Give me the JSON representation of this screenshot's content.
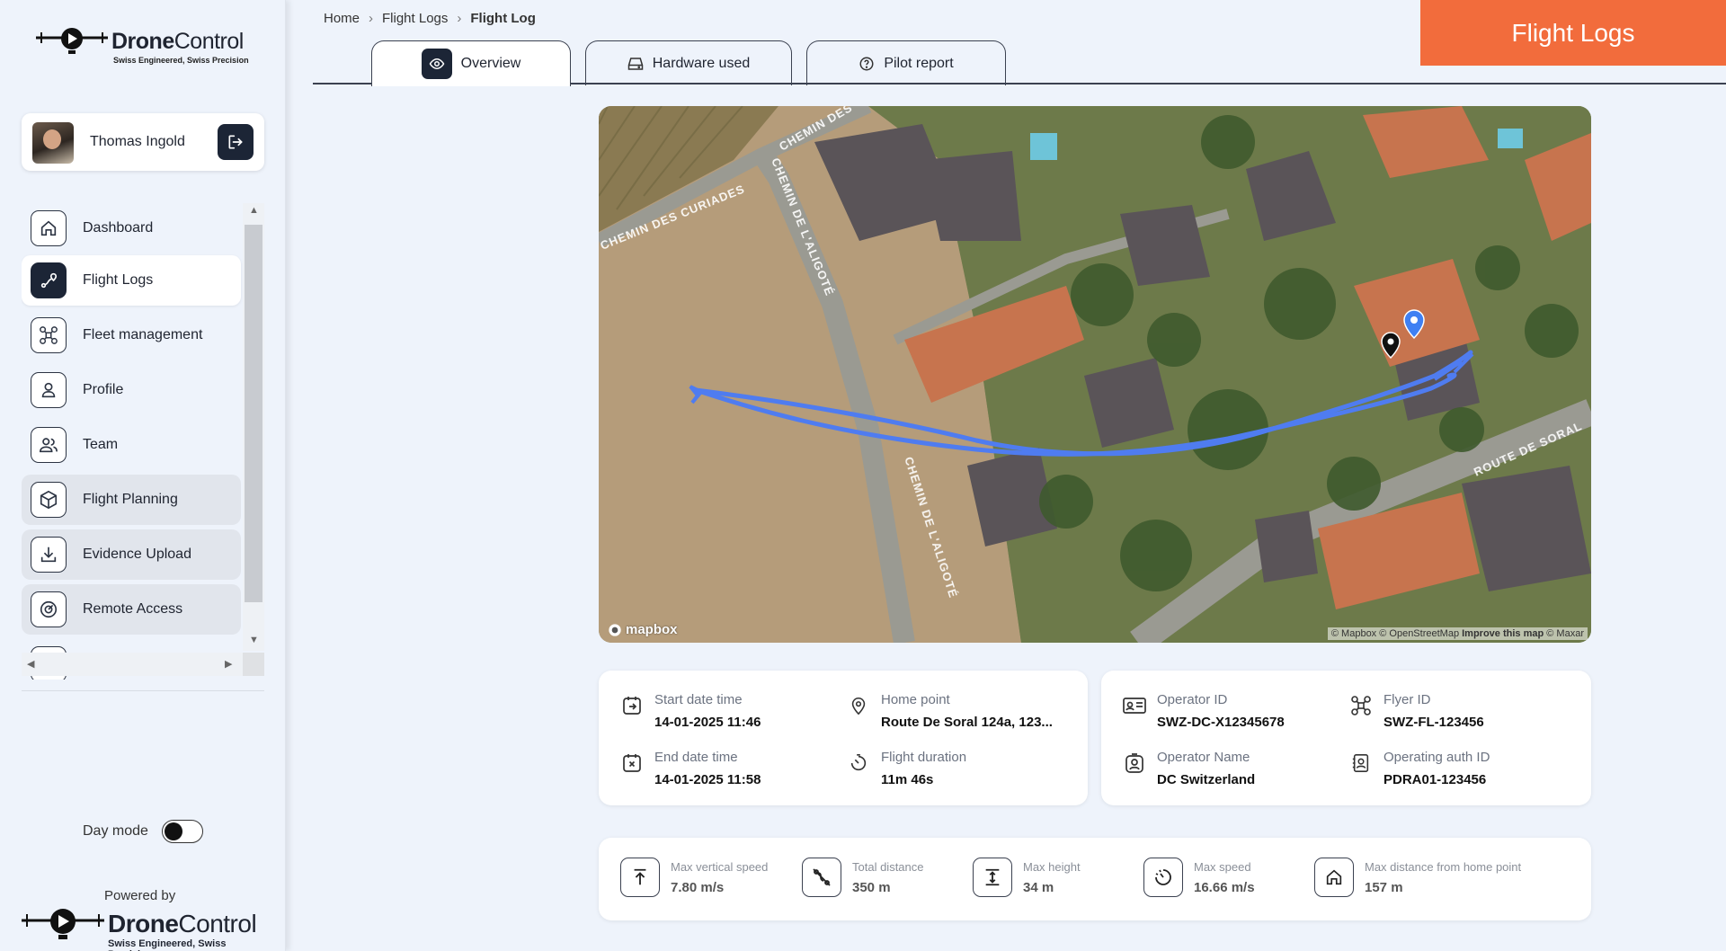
{
  "brand": {
    "name_bold": "Drone",
    "name_rest": "Control",
    "tagline": "Swiss Engineered, Swiss Precision"
  },
  "user": {
    "name": "Thomas Ingold"
  },
  "nav": {
    "items": [
      {
        "label": "Dashboard",
        "icon": "home-icon"
      },
      {
        "label": "Flight Logs",
        "icon": "flight-route-icon"
      },
      {
        "label": "Fleet management",
        "icon": "drone-icon"
      },
      {
        "label": "Profile",
        "icon": "user-icon"
      },
      {
        "label": "Team",
        "icon": "users-icon"
      },
      {
        "label": "Flight Planning",
        "icon": "cube-icon"
      },
      {
        "label": "Evidence Upload",
        "icon": "download-icon"
      },
      {
        "label": "Remote Access",
        "icon": "target-icon"
      }
    ]
  },
  "footer": {
    "day_mode_label": "Day mode",
    "powered_by": "Powered by"
  },
  "breadcrumb": [
    "Home",
    "Flight Logs",
    "Flight Log"
  ],
  "page_badge": "Flight Logs",
  "tabs": [
    {
      "label": "Overview",
      "icon": "eye-icon"
    },
    {
      "label": "Hardware used",
      "icon": "hard-drive-icon"
    },
    {
      "label": "Pilot report",
      "icon": "help-circle-icon"
    }
  ],
  "map": {
    "street_labels": [
      "CHEMIN DES CURIADES",
      "CHEMIN DE L'ALIGOTÉ",
      "CHEMIN DE L'ALIGOTÉ",
      "ROUTE DE SORAL",
      "CHEMIN DES"
    ],
    "logo_text": "mapbox",
    "attribution": "© Mapbox © OpenStreetMap",
    "improve": "Improve this map",
    "maxar": "© Maxar"
  },
  "flight": {
    "start_label": "Start date time",
    "start_value": "14-01-2025 11:46",
    "end_label": "End date time",
    "end_value": "14-01-2025 11:58",
    "home_label": "Home point",
    "home_value": "Route De Soral 124a, 123...",
    "duration_label": "Flight duration",
    "duration_value": "11m 46s"
  },
  "operator": {
    "op_id_label": "Operator ID",
    "op_id_value": "SWZ-DC-X12345678",
    "op_name_label": "Operator Name",
    "op_name_value": "DC Switzerland",
    "flyer_label": "Flyer ID",
    "flyer_value": "SWZ-FL-123456",
    "auth_label": "Operating auth ID",
    "auth_value": "PDRA01-123456"
  },
  "stats": [
    {
      "label": "Max vertical speed",
      "value": "7.80 m/s",
      "icon": "arrow-up-icon"
    },
    {
      "label": "Total distance",
      "value": "350 m",
      "icon": "route-icon"
    },
    {
      "label": "Max height",
      "value": "34 m",
      "icon": "height-icon"
    },
    {
      "label": "Max speed",
      "value": "16.66 m/s",
      "icon": "speedometer-icon"
    },
    {
      "label": "Max distance from home point",
      "value": "157 m",
      "icon": "home-icon"
    }
  ],
  "colors": {
    "accent": "#f26c3c",
    "dark": "#1c2536",
    "background": "#eef3fb",
    "flight_path": "#4f7cf0"
  }
}
